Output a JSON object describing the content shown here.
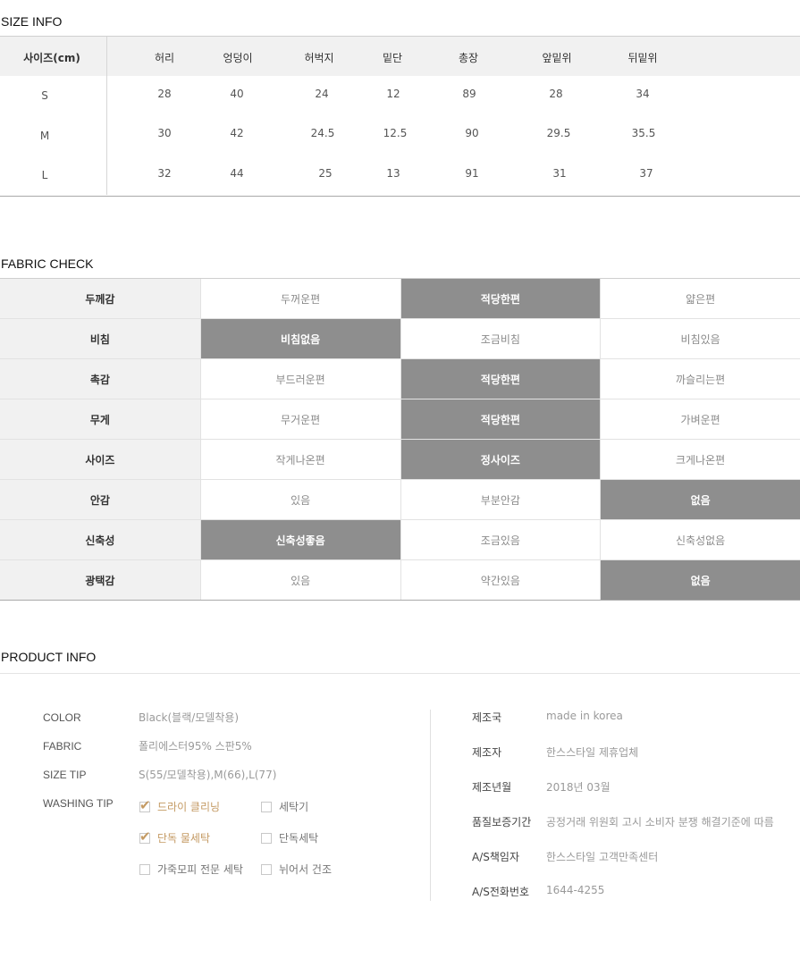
{
  "size_info": {
    "title": "SIZE INFO",
    "headers": [
      "사이즈(cm)",
      "허리",
      "엉덩이",
      "허벅지",
      "밑단",
      "총장",
      "앞밑위",
      "뒤밑위"
    ],
    "rows": [
      [
        "S",
        "28",
        "40",
        "24",
        "12",
        "89",
        "28",
        "34"
      ],
      [
        "M",
        "30",
        "42",
        "24.5",
        "12.5",
        "90",
        "29.5",
        "35.5"
      ],
      [
        "L",
        "32",
        "44",
        "25",
        "13",
        "91",
        "31",
        "37"
      ]
    ]
  },
  "fabric_check": {
    "title": "FABRIC CHECK",
    "rows": [
      {
        "label": "두께감",
        "options": [
          "두꺼운편",
          "적당한편",
          "얇은편"
        ],
        "selected": 1
      },
      {
        "label": "비침",
        "options": [
          "비침없음",
          "조금비침",
          "비침있음"
        ],
        "selected": 0
      },
      {
        "label": "촉감",
        "options": [
          "부드러운편",
          "적당한편",
          "까슬리는편"
        ],
        "selected": 1
      },
      {
        "label": "무게",
        "options": [
          "무거운편",
          "적당한편",
          "가벼운편"
        ],
        "selected": 1
      },
      {
        "label": "사이즈",
        "options": [
          "작게나온편",
          "정사이즈",
          "크게나온편"
        ],
        "selected": 1
      },
      {
        "label": "안감",
        "options": [
          "있음",
          "부분안감",
          "없음"
        ],
        "selected": 2
      },
      {
        "label": "신축성",
        "options": [
          "신축성좋음",
          "조금있음",
          "신축성없음"
        ],
        "selected": 0
      },
      {
        "label": "광택감",
        "options": [
          "있음",
          "약간있음",
          "없음"
        ],
        "selected": 2
      }
    ]
  },
  "product_info": {
    "title": "PRODUCT INFO",
    "color_label": "COLOR",
    "color_value": "Black(블랙/모델착용)",
    "fabric_label": "FABRIC",
    "fabric_value": "폴리에스터95% 스판5%",
    "size_tip_label": "SIZE TIP",
    "size_tip_value": "S(55/모델착용),M(66),L(77)",
    "washing_label": "WASHING TIP",
    "washing": [
      {
        "label": "드라이 클리닝",
        "checked": true
      },
      {
        "label": "세탁기",
        "checked": false
      },
      {
        "label": "단독 물세탁",
        "checked": true
      },
      {
        "label": "단독세탁",
        "checked": false
      },
      {
        "label": "가죽모피 전문 세탁",
        "checked": false
      },
      {
        "label": "뉘어서 건조",
        "checked": false
      }
    ],
    "details": [
      {
        "label": "제조국",
        "value": "made in korea"
      },
      {
        "label": "제조자",
        "value": "한스스타일 제휴업체"
      },
      {
        "label": "제조년월",
        "value": "2018년 03월"
      },
      {
        "label": "품질보증기간",
        "value": "공정거래 위원회 고시 소비자 분쟁 해결기준에 따름"
      },
      {
        "label": "A/S책임자",
        "value": "한스스타일 고객만족센터"
      },
      {
        "label": "A/S전화번호",
        "value": "1644-4255"
      }
    ]
  },
  "colors": {
    "selected_bg": "#8e8e8e",
    "header_bg": "#f1f1f1",
    "check_accent": "#c49a63"
  }
}
